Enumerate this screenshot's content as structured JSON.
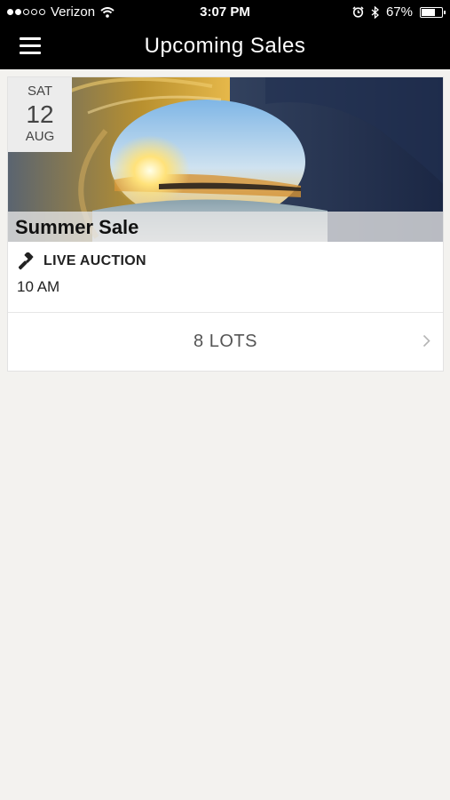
{
  "status_bar": {
    "carrier": "Verizon",
    "time": "3:07 PM",
    "battery": "67%",
    "battery_level": 0.67,
    "signal_bars_filled": 2,
    "signal_bars_total": 5
  },
  "nav": {
    "title": "Upcoming Sales",
    "menu_icon": "hamburger-menu-icon"
  },
  "sale": {
    "date": {
      "dow": "SAT",
      "day": "12",
      "month": "AUG"
    },
    "title": "Summer Sale",
    "type": "LIVE AUCTION",
    "type_icon": "gavel-icon",
    "time": "10 AM",
    "lots": "8 LOTS"
  },
  "colors": {
    "bar_bg": "#000000",
    "page_bg": "#f3f2ef",
    "card_bg": "#ffffff"
  }
}
